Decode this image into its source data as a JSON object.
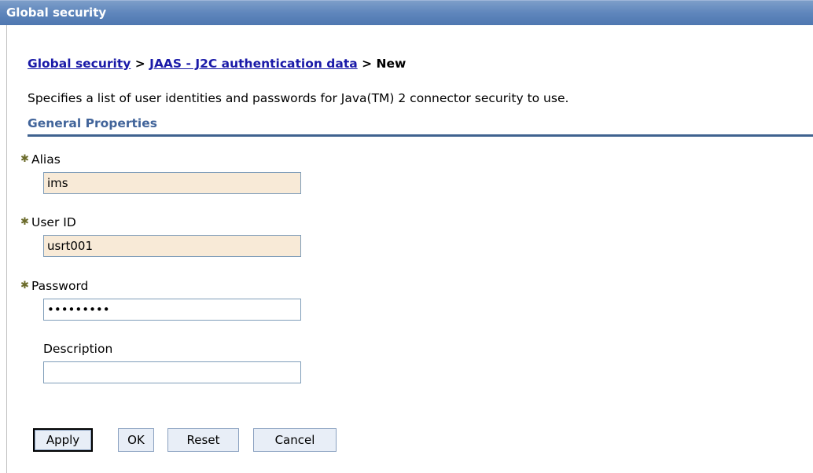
{
  "window": {
    "title": "Global security"
  },
  "breadcrumb": {
    "link1": "Global security",
    "sep1": " > ",
    "link2": "JAAS - J2C authentication data",
    "sep2": " > ",
    "current": "New"
  },
  "description": "Specifies a list of user identities and passwords for Java(TM) 2 connector security to use.",
  "section": {
    "title": "General Properties"
  },
  "form": {
    "required_marker": "✱",
    "alias": {
      "label": "Alias",
      "value": "ims"
    },
    "user_id": {
      "label": "User ID",
      "value": "usrt001"
    },
    "password": {
      "label": "Password",
      "value": "•••••••••"
    },
    "description": {
      "label": "Description",
      "value": ""
    }
  },
  "buttons": {
    "apply": "Apply",
    "ok": "OK",
    "reset": "Reset",
    "cancel": "Cancel"
  }
}
